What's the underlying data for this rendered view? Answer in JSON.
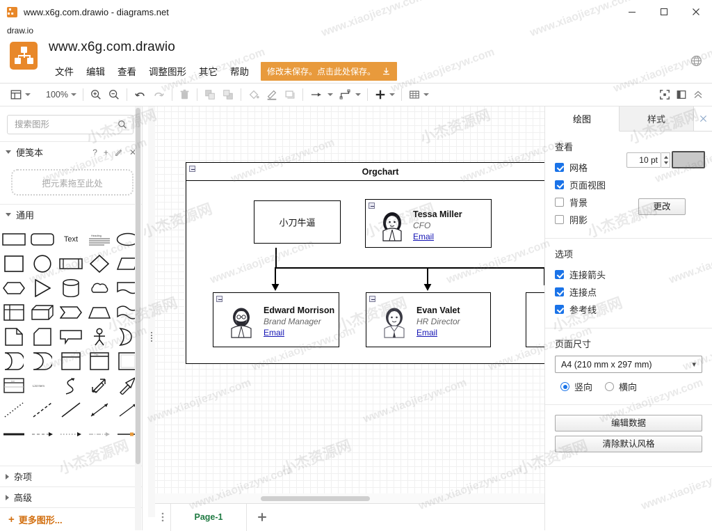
{
  "window": {
    "title": "www.x6g.com.drawio - diagrams.net",
    "app_icon": "drawio-logo-icon",
    "minimize": "−",
    "maximize": "□",
    "close": "✕",
    "subtitle": "draw.io"
  },
  "header": {
    "document_name": "www.x6g.com.drawio",
    "menus": [
      {
        "label": "文件"
      },
      {
        "label": "编辑"
      },
      {
        "label": "查看"
      },
      {
        "label": "调整图形"
      },
      {
        "label": "其它"
      },
      {
        "label": "帮助"
      }
    ],
    "save_notice": "修改未保存。点击此处保存。",
    "save_icon": "download-icon",
    "language_icon": "globe-icon"
  },
  "toolbar": {
    "view_icon": "view-layout-icon",
    "zoom_level": "100%",
    "zoom_in_icon": "zoom-in-icon",
    "zoom_out_icon": "zoom-out-icon",
    "undo_icon": "undo-icon",
    "redo_icon": "redo-icon",
    "delete_icon": "trash-icon",
    "to_front_icon": "bring-to-front-icon",
    "to_back_icon": "send-to-back-icon",
    "fill_icon": "fill-color-icon",
    "line_icon": "line-color-icon",
    "shadow_icon": "shadow-icon",
    "connection_icon": "connection-arrow-icon",
    "waypoint_icon": "waypoint-icon",
    "insert_icon": "insert-plus-icon",
    "table_icon": "table-icon",
    "fullscreen_icon": "fullscreen-icon",
    "format_panel_icon": "toggle-format-panel-icon",
    "collapse_icon": "collapse-toolbar-icon"
  },
  "sidebar": {
    "search": {
      "placeholder": "搜索图形",
      "value": "",
      "icon": "search-icon"
    },
    "sections": [
      {
        "label": "便笺本",
        "expanded": true,
        "actions": [
          "?",
          "+",
          "✎",
          "✕"
        ],
        "dropzone": "把元素拖至此处"
      },
      {
        "label": "通用",
        "expanded": true
      },
      {
        "label": "杂项",
        "expanded": false
      },
      {
        "label": "高级",
        "expanded": false
      }
    ],
    "more_shapes": "更多图形...",
    "more_shapes_icon": "plus-icon",
    "shapes": [
      "rectangle",
      "rounded-rectangle",
      "text",
      "textbox",
      "ellipse",
      "square",
      "circle",
      "process",
      "rhombus",
      "parallelogram",
      "hexagon",
      "triangle",
      "cylinder",
      "cloud",
      "document",
      "internal-storage",
      "cube",
      "step",
      "trapezoid",
      "tape",
      "note",
      "card",
      "callout",
      "actor",
      "or-shape",
      "data-storage",
      "delay",
      "vertical-container",
      "horizontal-container",
      "container",
      "list",
      "list-item",
      "curved-arrow",
      "bidirectional-arrow",
      "single-arrow",
      "dotted-line",
      "dashed-line",
      "line",
      "bidirectional-connector",
      "directional-connector",
      "thick-line",
      "dashed-arrow-connector",
      "dotted-arrow-connector",
      "dashdot-connector",
      "labeled-connector"
    ]
  },
  "canvas": {
    "container_title": "Orgchart",
    "nodes": [
      {
        "id": "plain",
        "label": "小刀牛逼",
        "type": "plain"
      },
      {
        "id": "cfo",
        "name": "Tessa Miller",
        "role": "CFO",
        "email_label": "Email",
        "avatar": "woman-avatar-icon"
      },
      {
        "id": "brand",
        "name": "Edward Morrison",
        "role": "Brand Manager",
        "email_label": "Email",
        "avatar": "bearded-man-avatar-icon"
      },
      {
        "id": "hr",
        "name": "Evan Valet",
        "role": "HR Director",
        "email_label": "Email",
        "avatar": "man-avatar-icon"
      }
    ]
  },
  "footer": {
    "menu_icon": "page-menu-icon",
    "page_tab": "Page-1",
    "add_page_icon": "plus-icon"
  },
  "format_panel": {
    "tabs": [
      {
        "label": "绘图",
        "active": true
      },
      {
        "label": "样式",
        "active": false
      }
    ],
    "close_icon": "close-icon",
    "view": {
      "title": "查看",
      "options": [
        {
          "label": "网格",
          "checked": true
        },
        {
          "label": "页面视图",
          "checked": true
        },
        {
          "label": "背景",
          "checked": false
        },
        {
          "label": "阴影",
          "checked": false
        }
      ],
      "grid_size": "10 pt",
      "grid_color": "#c8c8c8",
      "change_button": "更改"
    },
    "options": {
      "title": "选项",
      "items": [
        {
          "label": "连接箭头",
          "checked": true
        },
        {
          "label": "连接点",
          "checked": true
        },
        {
          "label": "参考线",
          "checked": true
        }
      ]
    },
    "paper": {
      "title": "页面尺寸",
      "selected": "A4 (210 mm x 297 mm)",
      "orientation": [
        {
          "label": "竖向",
          "selected": true
        },
        {
          "label": "横向",
          "selected": false
        }
      ]
    },
    "buttons": [
      {
        "label": "编辑数据"
      },
      {
        "label": "清除默认风格"
      }
    ]
  },
  "watermarks": {
    "en": "www.xiaojiezyw.com",
    "cn": "小杰资源网"
  },
  "colors": {
    "accent_orange": "#e8882a",
    "save_orange": "#e89a3c",
    "link_blue": "#1414b4",
    "checkbox_blue": "#1a73e8",
    "page_tab_green": "#1f7a42"
  }
}
